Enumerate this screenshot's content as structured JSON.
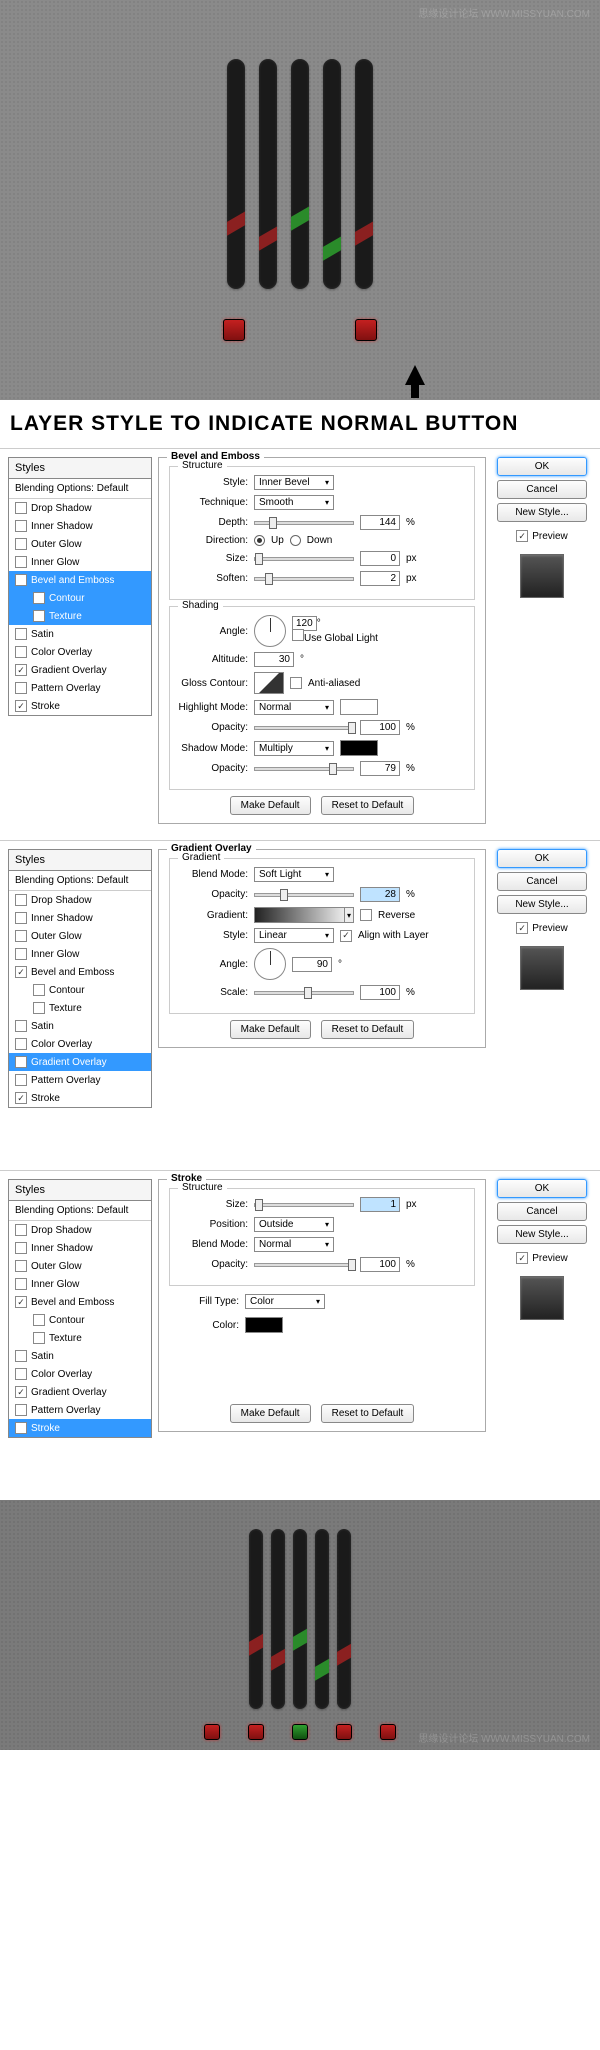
{
  "watermark": "思缘设计论坛 WWW.MISSYUAN.COM",
  "title_banner": "LAYER STYLE TO INDICATE NORMAL BUTTON",
  "styles_header": "Styles",
  "blending_label": "Blending Options: Default",
  "style_items": {
    "drop_shadow": "Drop Shadow",
    "inner_shadow": "Inner Shadow",
    "outer_glow": "Outer Glow",
    "inner_glow": "Inner Glow",
    "bevel_emboss": "Bevel and Emboss",
    "contour": "Contour",
    "texture": "Texture",
    "satin": "Satin",
    "color_overlay": "Color Overlay",
    "gradient_overlay": "Gradient Overlay",
    "pattern_overlay": "Pattern Overlay",
    "stroke": "Stroke"
  },
  "right": {
    "ok": "OK",
    "cancel": "Cancel",
    "new_style": "New Style...",
    "preview": "Preview"
  },
  "common": {
    "make_default": "Make Default",
    "reset_default": "Reset to Default"
  },
  "bevel": {
    "panel_title": "Bevel and Emboss",
    "structure": "Structure",
    "style_label": "Style:",
    "style_value": "Inner Bevel",
    "technique_label": "Technique:",
    "technique_value": "Smooth",
    "depth_label": "Depth:",
    "depth_value": "144",
    "direction_label": "Direction:",
    "up": "Up",
    "down": "Down",
    "size_label": "Size:",
    "size_value": "0",
    "soften_label": "Soften:",
    "soften_value": "2",
    "shading": "Shading",
    "angle_label": "Angle:",
    "angle_value": "120",
    "use_global": "Use Global Light",
    "altitude_label": "Altitude:",
    "altitude_value": "30",
    "gloss_label": "Gloss Contour:",
    "anti_aliased": "Anti-aliased",
    "highlight_label": "Highlight Mode:",
    "highlight_value": "Normal",
    "opacity_label": "Opacity:",
    "hi_opacity": "100",
    "shadow_label": "Shadow Mode:",
    "shadow_value": "Multiply",
    "sh_opacity": "79",
    "pct": "%",
    "px": "px",
    "deg": "°"
  },
  "gradient": {
    "panel_title": "Gradient Overlay",
    "gradient_sub": "Gradient",
    "blend_label": "Blend Mode:",
    "blend_value": "Soft Light",
    "opacity_label": "Opacity:",
    "opacity_value": "28",
    "gradient_label": "Gradient:",
    "reverse": "Reverse",
    "style_label": "Style:",
    "style_value": "Linear",
    "align": "Align with Layer",
    "angle_label": "Angle:",
    "angle_value": "90",
    "scale_label": "Scale:",
    "scale_value": "100"
  },
  "stroke": {
    "panel_title": "Stroke",
    "structure": "Structure",
    "size_label": "Size:",
    "size_value": "1",
    "position_label": "Position:",
    "position_value": "Outside",
    "blend_label": "Blend Mode:",
    "blend_value": "Normal",
    "opacity_label": "Opacity:",
    "opacity_value": "100",
    "fill_label": "Fill Type:",
    "fill_value": "Color",
    "color_label": "Color:"
  }
}
